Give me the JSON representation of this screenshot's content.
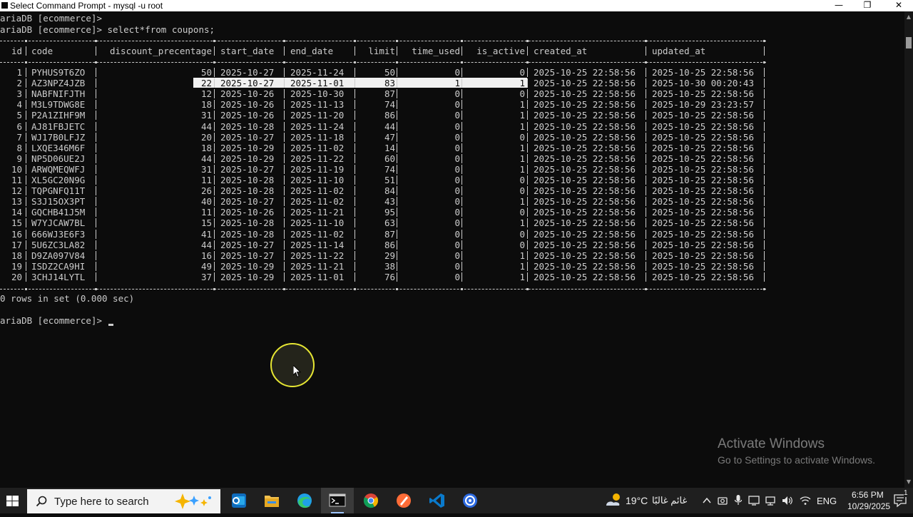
{
  "window": {
    "title": "Select Command Prompt - mysql  -u root",
    "minimize": "—",
    "restore": "❐",
    "close": "✕"
  },
  "console": {
    "prompt_prev": "ariaDB [ecommerce]>",
    "prompt_query": "ariaDB [ecommerce]> select*from coupons;",
    "result_footer": "0 rows in set (0.000 sec)",
    "prompt_current": "ariaDB [ecommerce]>"
  },
  "table": {
    "columns": [
      "id",
      "code",
      "discount_precentage",
      "start_date",
      "end_date",
      "limit",
      "time_used",
      "is_active",
      "created_at",
      "updated_at"
    ],
    "rows": [
      [
        "1",
        "PYHUS9T6ZO",
        "50",
        "2025-10-27",
        "2025-11-24",
        "50",
        "0",
        "0",
        "2025-10-25 22:58:56",
        "2025-10-25 22:58:56"
      ],
      [
        "2",
        "AZ3NPZ4JZB",
        "22",
        "2025-10-27",
        "2025-11-01",
        "83",
        "1",
        "1",
        "2025-10-25 22:58:56",
        "2025-10-30 00:20:43"
      ],
      [
        "3",
        "NABFNIFJTH",
        "12",
        "2025-10-26",
        "2025-10-30",
        "87",
        "0",
        "0",
        "2025-10-25 22:58:56",
        "2025-10-25 22:58:56"
      ],
      [
        "4",
        "M3L9TDWG8E",
        "18",
        "2025-10-26",
        "2025-11-13",
        "74",
        "0",
        "1",
        "2025-10-25 22:58:56",
        "2025-10-29 23:23:57"
      ],
      [
        "5",
        "P2A1ZIHF9M",
        "31",
        "2025-10-26",
        "2025-11-20",
        "86",
        "0",
        "1",
        "2025-10-25 22:58:56",
        "2025-10-25 22:58:56"
      ],
      [
        "6",
        "AJ81FBJETC",
        "44",
        "2025-10-28",
        "2025-11-24",
        "44",
        "0",
        "1",
        "2025-10-25 22:58:56",
        "2025-10-25 22:58:56"
      ],
      [
        "7",
        "WJ17B0LFJZ",
        "20",
        "2025-10-27",
        "2025-11-18",
        "47",
        "0",
        "0",
        "2025-10-25 22:58:56",
        "2025-10-25 22:58:56"
      ],
      [
        "8",
        "LXQE346M6F",
        "18",
        "2025-10-29",
        "2025-11-02",
        "14",
        "0",
        "1",
        "2025-10-25 22:58:56",
        "2025-10-25 22:58:56"
      ],
      [
        "9",
        "NP5D06UE2J",
        "44",
        "2025-10-29",
        "2025-11-22",
        "60",
        "0",
        "1",
        "2025-10-25 22:58:56",
        "2025-10-25 22:58:56"
      ],
      [
        "10",
        "ARWQMEQWFJ",
        "31",
        "2025-10-27",
        "2025-11-19",
        "74",
        "0",
        "1",
        "2025-10-25 22:58:56",
        "2025-10-25 22:58:56"
      ],
      [
        "11",
        "XL5GC20N9G",
        "11",
        "2025-10-28",
        "2025-11-10",
        "51",
        "0",
        "0",
        "2025-10-25 22:58:56",
        "2025-10-25 22:58:56"
      ],
      [
        "12",
        "TQPGNFQ11T",
        "26",
        "2025-10-28",
        "2025-11-02",
        "84",
        "0",
        "0",
        "2025-10-25 22:58:56",
        "2025-10-25 22:58:56"
      ],
      [
        "13",
        "S3J15OX3PT",
        "40",
        "2025-10-27",
        "2025-11-02",
        "43",
        "0",
        "1",
        "2025-10-25 22:58:56",
        "2025-10-25 22:58:56"
      ],
      [
        "14",
        "GQCHB41J5M",
        "11",
        "2025-10-26",
        "2025-11-21",
        "95",
        "0",
        "0",
        "2025-10-25 22:58:56",
        "2025-10-25 22:58:56"
      ],
      [
        "15",
        "W7YJCAW7BL",
        "15",
        "2025-10-28",
        "2025-11-10",
        "63",
        "0",
        "1",
        "2025-10-25 22:58:56",
        "2025-10-25 22:58:56"
      ],
      [
        "16",
        "666WJ3E6F3",
        "41",
        "2025-10-28",
        "2025-11-02",
        "87",
        "0",
        "0",
        "2025-10-25 22:58:56",
        "2025-10-25 22:58:56"
      ],
      [
        "17",
        "5U6ZC3LA82",
        "44",
        "2025-10-27",
        "2025-11-14",
        "86",
        "0",
        "0",
        "2025-10-25 22:58:56",
        "2025-10-25 22:58:56"
      ],
      [
        "18",
        "D9ZA097V84",
        "16",
        "2025-10-27",
        "2025-11-22",
        "29",
        "0",
        "1",
        "2025-10-25 22:58:56",
        "2025-10-25 22:58:56"
      ],
      [
        "19",
        "ISDZ2CA9HI",
        "49",
        "2025-10-29",
        "2025-11-21",
        "38",
        "0",
        "1",
        "2025-10-25 22:58:56",
        "2025-10-25 22:58:56"
      ],
      [
        "20",
        "3CHJ14LYTL",
        "37",
        "2025-10-29",
        "2025-11-01",
        "76",
        "0",
        "1",
        "2025-10-25 22:58:56",
        "2025-10-25 22:58:56"
      ]
    ],
    "selected_row_index": 1
  },
  "watermark": {
    "title": "Activate Windows",
    "subtitle": "Go to Settings to activate Windows."
  },
  "taskbar": {
    "search_placeholder": "Type here to search",
    "apps": [
      "outlook-icon",
      "file-explorer-icon",
      "edge-icon",
      "command-prompt-icon",
      "chrome-icon",
      "postman-icon",
      "vscode-icon",
      "app-icon"
    ],
    "active_app": "command-prompt-icon",
    "weather_temp": "19°C",
    "weather_text": "غائم غالبًا",
    "language": "ENG",
    "time": "6:56 PM",
    "date": "10/29/2025",
    "notification_count": "1"
  },
  "colors": {
    "console_bg": "#0c0c0c",
    "console_fg": "#cccccc",
    "highlight_bg": "#f0f0f0",
    "taskbar_bg": "#1f1f1f",
    "mouse_ring": "#e6e633"
  }
}
